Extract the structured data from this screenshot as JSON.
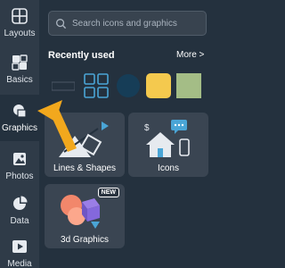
{
  "nav": {
    "items": [
      {
        "label": "Layouts",
        "icon": "layout-grid-icon"
      },
      {
        "label": "Basics",
        "icon": "blocks-icon"
      },
      {
        "label": "Graphics",
        "icon": "graphics-icon",
        "active": true
      },
      {
        "label": "Photos",
        "icon": "photo-icon"
      },
      {
        "label": "Data",
        "icon": "pie-chart-icon"
      },
      {
        "label": "Media",
        "icon": "media-play-icon"
      }
    ]
  },
  "search": {
    "placeholder": "Search icons and graphics"
  },
  "recently_used": {
    "title": "Recently used",
    "more": "More >",
    "swatches": [
      "#163d57",
      "#f4c94e",
      "#a4bd86"
    ]
  },
  "cards": [
    {
      "label": "Lines & Shapes"
    },
    {
      "label": "Icons"
    },
    {
      "label": "3d Graphics",
      "badge": "NEW"
    }
  ],
  "colors": {
    "background": "#24313e",
    "rail": "#2f3b48",
    "accent_arrow": "#f2a81d",
    "icon_blue": "#4aa5d6"
  }
}
